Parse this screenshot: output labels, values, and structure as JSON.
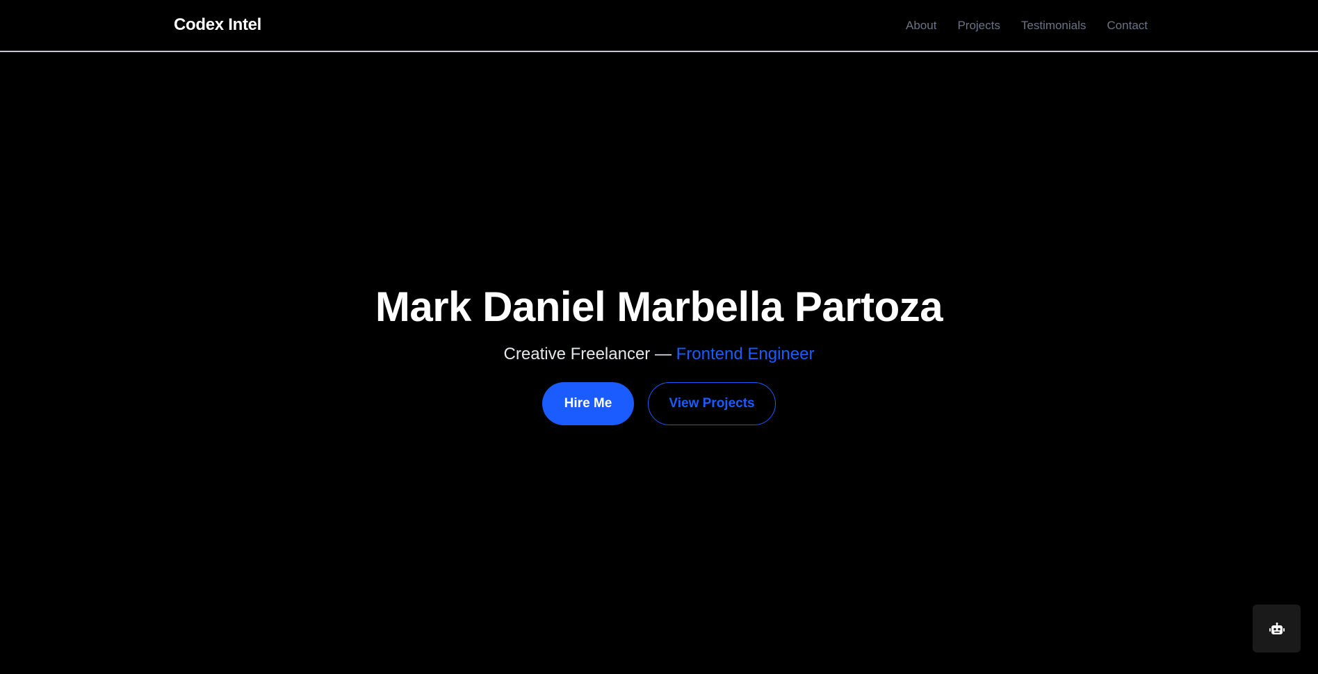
{
  "header": {
    "brand": "Codex Intel",
    "nav": [
      {
        "label": "About"
      },
      {
        "label": "Projects"
      },
      {
        "label": "Testimonials"
      },
      {
        "label": "Contact"
      }
    ]
  },
  "hero": {
    "title": "Mark Daniel Marbella Partoza",
    "subtitle_prefix": "Creative Freelancer — ",
    "subtitle_accent": "Frontend Engineer",
    "primary_button": "Hire Me",
    "secondary_button": "View Projects"
  },
  "chat_widget": {
    "icon": "robot-icon"
  },
  "colors": {
    "background": "#000000",
    "accent": "#1a5cff",
    "nav_text": "#6b7386",
    "divider": "#c7cad6",
    "fab_background": "#1a1a1a"
  }
}
